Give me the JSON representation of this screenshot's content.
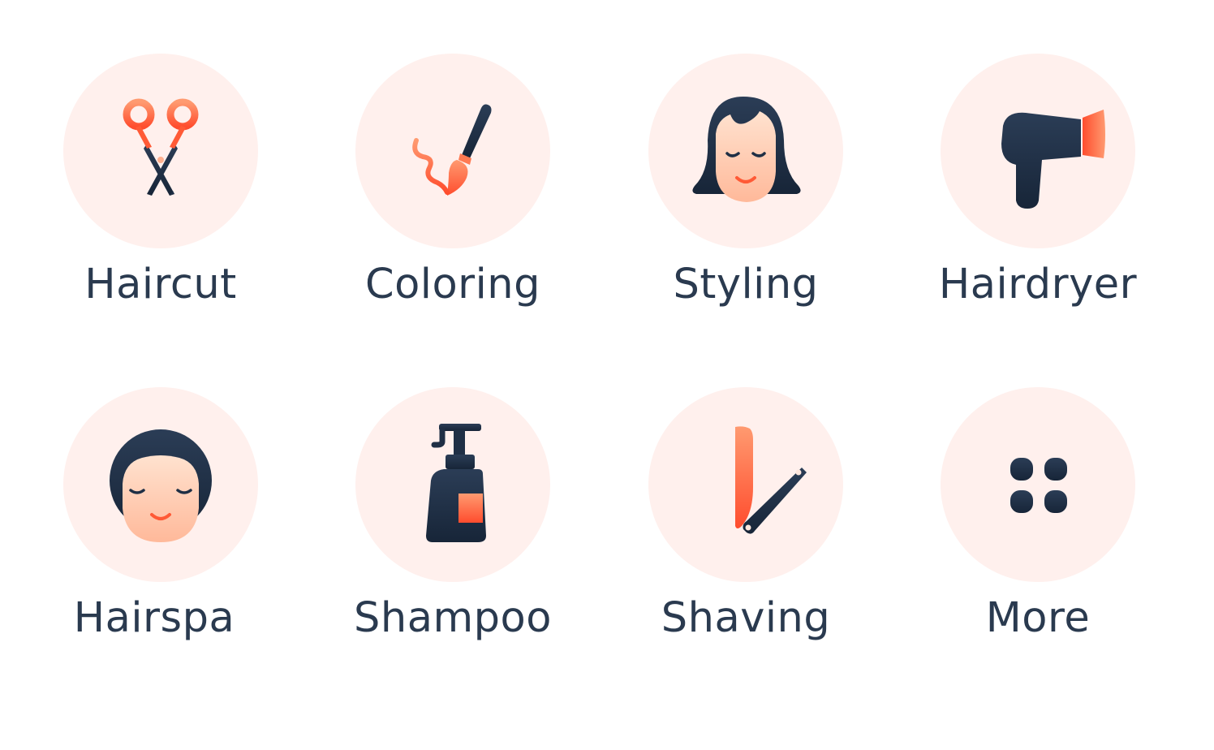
{
  "colors": {
    "circle_bg": "#fff0ed",
    "label_text": "#2a3a4f",
    "icon_dark": "#1f2f45",
    "icon_accent": "#ff5a36",
    "icon_accent_light": "#ff8a64",
    "skin": "#ffcfb4"
  },
  "services": [
    {
      "label": "Haircut",
      "icon": "scissors-icon"
    },
    {
      "label": "Coloring",
      "icon": "paintbrush-icon"
    },
    {
      "label": "Styling",
      "icon": "woman-face-icon"
    },
    {
      "label": "Hairdryer",
      "icon": "hairdryer-icon"
    },
    {
      "label": "Hairspa",
      "icon": "spa-face-icon"
    },
    {
      "label": "Shampoo",
      "icon": "shampoo-bottle-icon"
    },
    {
      "label": "Shaving",
      "icon": "razor-icon"
    },
    {
      "label": "More",
      "icon": "grid-dots-icon"
    }
  ]
}
